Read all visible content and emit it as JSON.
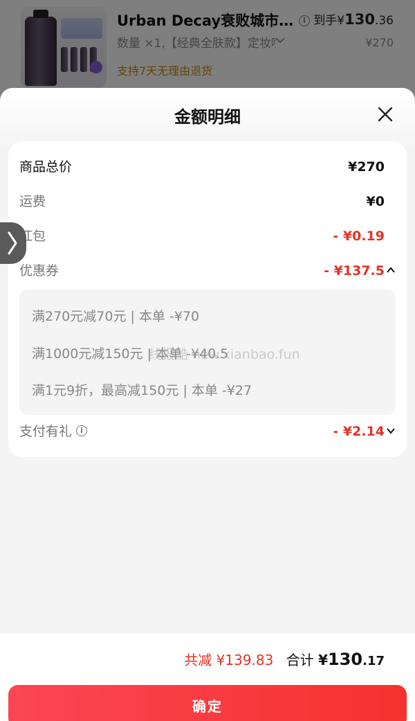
{
  "product": {
    "title": "Urban Decay衰败城市…",
    "spec": "数量 ×1,【经典全肤款】定妆喷",
    "return_policy": "支持7天无理由退货",
    "final_price_prefix": "到手",
    "final_price_currency": "¥",
    "final_price_int": "130",
    "final_price_dec": ".36",
    "original_price": "¥270"
  },
  "sheet": {
    "title": "金额明细"
  },
  "details": {
    "goods_total": {
      "label": "商品总价",
      "value": "¥270"
    },
    "shipping": {
      "label": "运费",
      "value": "¥0"
    },
    "red_packet": {
      "label": "红包",
      "value": "- ¥0.19"
    },
    "coupon": {
      "label": "优惠券",
      "value": "- ¥137.5"
    },
    "coupon_items": [
      "满270元减70元 | 本单 -¥70",
      "满1000元减150元 | 本单 -¥40.5",
      "满1元9折，最高减150元 | 本单 -¥27"
    ],
    "payment_gift": {
      "label": "支付有礼",
      "value": "- ¥2.14"
    }
  },
  "watermark": "线报酷 new.xianbao.fun",
  "summary": {
    "saved": "共减 ¥139.83",
    "total_label": "合计",
    "total_currency": "¥",
    "total_int": "130",
    "total_dec": ".17"
  },
  "confirm_button": "确定",
  "colors": {
    "accent_red": "#e33326",
    "button_gradient_start": "#fb4654",
    "button_gradient_end": "#f6322e",
    "return_policy": "#c9861b"
  },
  "icons": [
    "info-icon",
    "chevron-down-icon",
    "close-icon",
    "chevron-up-icon",
    "chevron-right-icon"
  ]
}
